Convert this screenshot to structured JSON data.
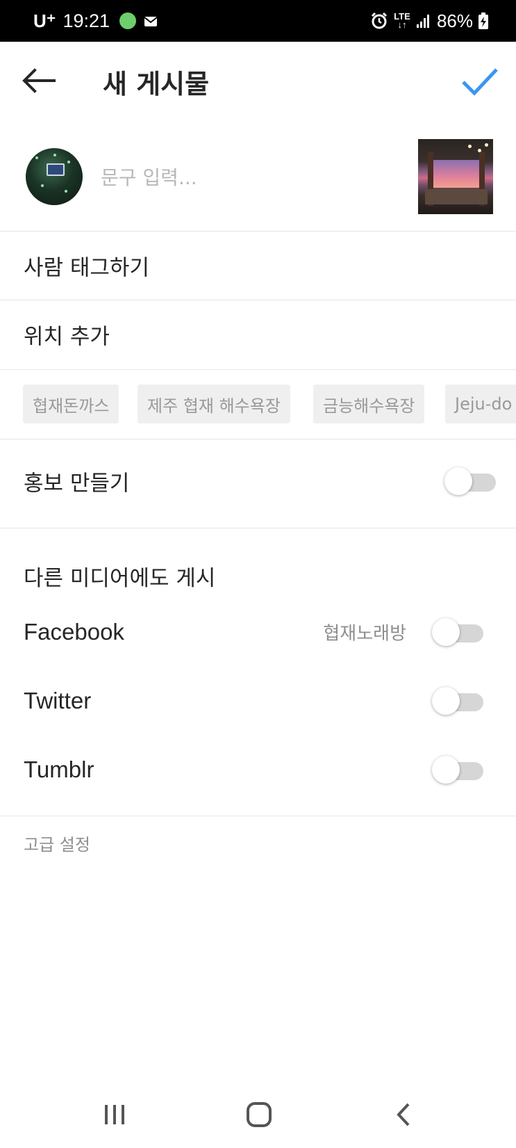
{
  "status_bar": {
    "carrier": "U⁺",
    "time": "19:21",
    "network": "LTE",
    "battery": "86%",
    "icons": [
      "line-app-icon",
      "mail-icon",
      "alarm-icon",
      "lte-icon",
      "signal-icon",
      "battery-charging-icon"
    ]
  },
  "header": {
    "back_icon": "arrow-left-icon",
    "title": "새 게시물",
    "confirm_icon": "check-icon",
    "accent": "#3897f0"
  },
  "caption": {
    "placeholder": "문구 입력...",
    "value": ""
  },
  "menu": {
    "tag_people": "사람 태그하기",
    "add_location": "위치 추가"
  },
  "location_suggestions": [
    "협재돈까스",
    "제주 협재 해수욕장",
    "금능해수욕장",
    "Jeju-do"
  ],
  "promotion": {
    "label": "홍보 만들기",
    "enabled": false
  },
  "share": {
    "heading": "다른 미디어에도 게시",
    "items": [
      {
        "label": "Facebook",
        "account": "협재노래방",
        "enabled": false
      },
      {
        "label": "Twitter",
        "account": "",
        "enabled": false
      },
      {
        "label": "Tumblr",
        "account": "",
        "enabled": false
      }
    ]
  },
  "advanced_settings": "고급 설정",
  "nav_bar": {
    "icons": [
      "recent-apps-icon",
      "home-icon",
      "back-icon"
    ]
  }
}
